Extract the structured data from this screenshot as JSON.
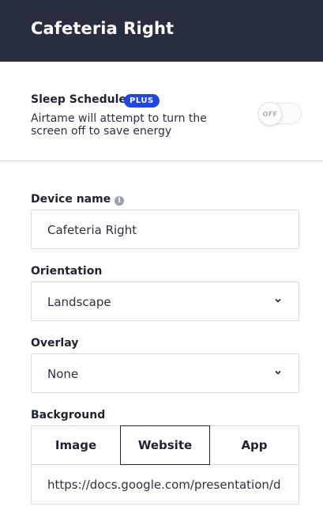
{
  "header": {
    "title": "Cafeteria Right"
  },
  "sleep_schedule": {
    "title": "Sleep Schedule",
    "badge": "PLUS",
    "description": "Airtame will attempt to turn the screen off to save energy",
    "toggle_state": "OFF"
  },
  "device_name": {
    "label": "Device name",
    "value": "Cafeteria Right"
  },
  "orientation": {
    "label": "Orientation",
    "selected": "Landscape"
  },
  "overlay": {
    "label": "Overlay",
    "selected": "None"
  },
  "background": {
    "label": "Background",
    "options": [
      "Image",
      "Website",
      "App"
    ],
    "active": "Website",
    "url": "https://docs.google.com/presentation/d"
  },
  "colors": {
    "header_bg": "#282d40",
    "plus_badge": "#2246e6"
  }
}
